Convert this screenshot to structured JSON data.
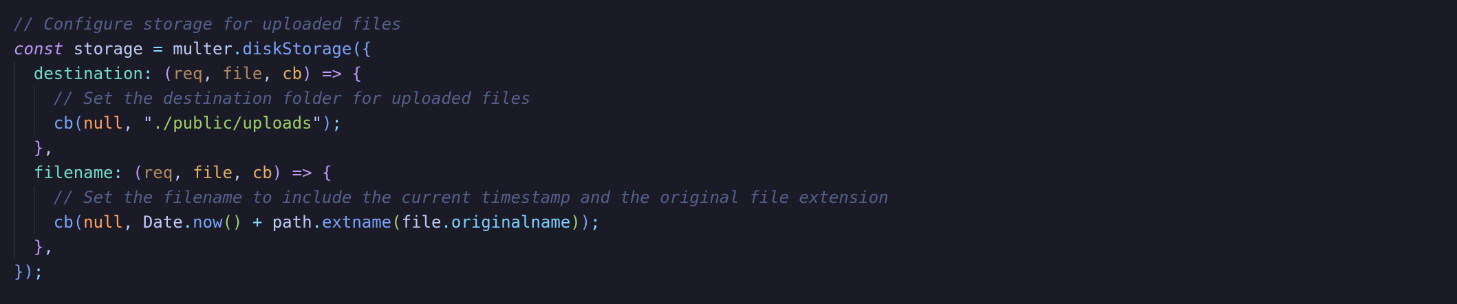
{
  "editor": {
    "language": "javascript",
    "theme_background": "#1a1b26",
    "lines": [
      {
        "indent": 0,
        "tokens": [
          {
            "t": "// Configure storage for uploaded files",
            "c": "comment"
          }
        ]
      },
      {
        "indent": 0,
        "tokens": [
          {
            "t": "const",
            "c": "keyword"
          },
          {
            "t": " storage ",
            "c": "variable"
          },
          {
            "t": "=",
            "c": "op"
          },
          {
            "t": " multer",
            "c": "obj"
          },
          {
            "t": ".",
            "c": "dot"
          },
          {
            "t": "diskStorage",
            "c": "fn"
          },
          {
            "t": "(",
            "c": "paren-b"
          },
          {
            "t": "{",
            "c": "brace"
          }
        ]
      },
      {
        "indent": 1,
        "tokens": [
          {
            "t": "destination",
            "c": "prop-key"
          },
          {
            "t": ": ",
            "c": "op"
          },
          {
            "t": "(",
            "c": "brace2"
          },
          {
            "t": "req",
            "c": "param-dim"
          },
          {
            "t": ", ",
            "c": "punct"
          },
          {
            "t": "file",
            "c": "param-dim"
          },
          {
            "t": ", ",
            "c": "punct"
          },
          {
            "t": "cb",
            "c": "param"
          },
          {
            "t": ")",
            "c": "brace2"
          },
          {
            "t": " => ",
            "c": "arrow"
          },
          {
            "t": "{",
            "c": "brace2"
          }
        ]
      },
      {
        "indent": 2,
        "tokens": [
          {
            "t": "// Set the destination folder for uploaded files",
            "c": "comment"
          }
        ]
      },
      {
        "indent": 2,
        "tokens": [
          {
            "t": "cb",
            "c": "fn"
          },
          {
            "t": "(",
            "c": "paren-b"
          },
          {
            "t": "null",
            "c": "null"
          },
          {
            "t": ", ",
            "c": "punct"
          },
          {
            "t": "\"",
            "c": "punct"
          },
          {
            "t": "./public/uploads",
            "c": "string"
          },
          {
            "t": "\"",
            "c": "punct"
          },
          {
            "t": ")",
            "c": "paren-b"
          },
          {
            "t": ";",
            "c": "op"
          }
        ]
      },
      {
        "indent": 1,
        "tokens": [
          {
            "t": "}",
            "c": "brace2"
          },
          {
            "t": ",",
            "c": "punct"
          }
        ]
      },
      {
        "indent": 1,
        "tokens": [
          {
            "t": "filename",
            "c": "prop-key"
          },
          {
            "t": ": ",
            "c": "op"
          },
          {
            "t": "(",
            "c": "brace2"
          },
          {
            "t": "req",
            "c": "param-dim"
          },
          {
            "t": ", ",
            "c": "punct"
          },
          {
            "t": "file",
            "c": "param"
          },
          {
            "t": ", ",
            "c": "punct"
          },
          {
            "t": "cb",
            "c": "param"
          },
          {
            "t": ")",
            "c": "brace2"
          },
          {
            "t": " => ",
            "c": "arrow"
          },
          {
            "t": "{",
            "c": "brace2"
          }
        ]
      },
      {
        "indent": 2,
        "tokens": [
          {
            "t": "// Set the filename to include the current timestamp and the original file extension",
            "c": "comment"
          }
        ]
      },
      {
        "indent": 2,
        "tokens": [
          {
            "t": "cb",
            "c": "fn"
          },
          {
            "t": "(",
            "c": "paren-b"
          },
          {
            "t": "null",
            "c": "null"
          },
          {
            "t": ", ",
            "c": "punct"
          },
          {
            "t": "Date",
            "c": "obj"
          },
          {
            "t": ".",
            "c": "dot"
          },
          {
            "t": "now",
            "c": "fn"
          },
          {
            "t": "()",
            "c": "paren"
          },
          {
            "t": " + ",
            "c": "op"
          },
          {
            "t": "path",
            "c": "obj"
          },
          {
            "t": ".",
            "c": "dot"
          },
          {
            "t": "extname",
            "c": "fn"
          },
          {
            "t": "(",
            "c": "paren"
          },
          {
            "t": "file",
            "c": "obj"
          },
          {
            "t": ".",
            "c": "dot"
          },
          {
            "t": "originalname",
            "c": "prop"
          },
          {
            "t": ")",
            "c": "paren"
          },
          {
            "t": ")",
            "c": "paren-b"
          },
          {
            "t": ";",
            "c": "op"
          }
        ]
      },
      {
        "indent": 1,
        "tokens": [
          {
            "t": "}",
            "c": "brace2"
          },
          {
            "t": ",",
            "c": "punct"
          }
        ]
      },
      {
        "indent": 0,
        "tokens": [
          {
            "t": "}",
            "c": "brace"
          },
          {
            "t": ")",
            "c": "paren-b"
          },
          {
            "t": ";",
            "c": "op"
          }
        ]
      }
    ]
  }
}
